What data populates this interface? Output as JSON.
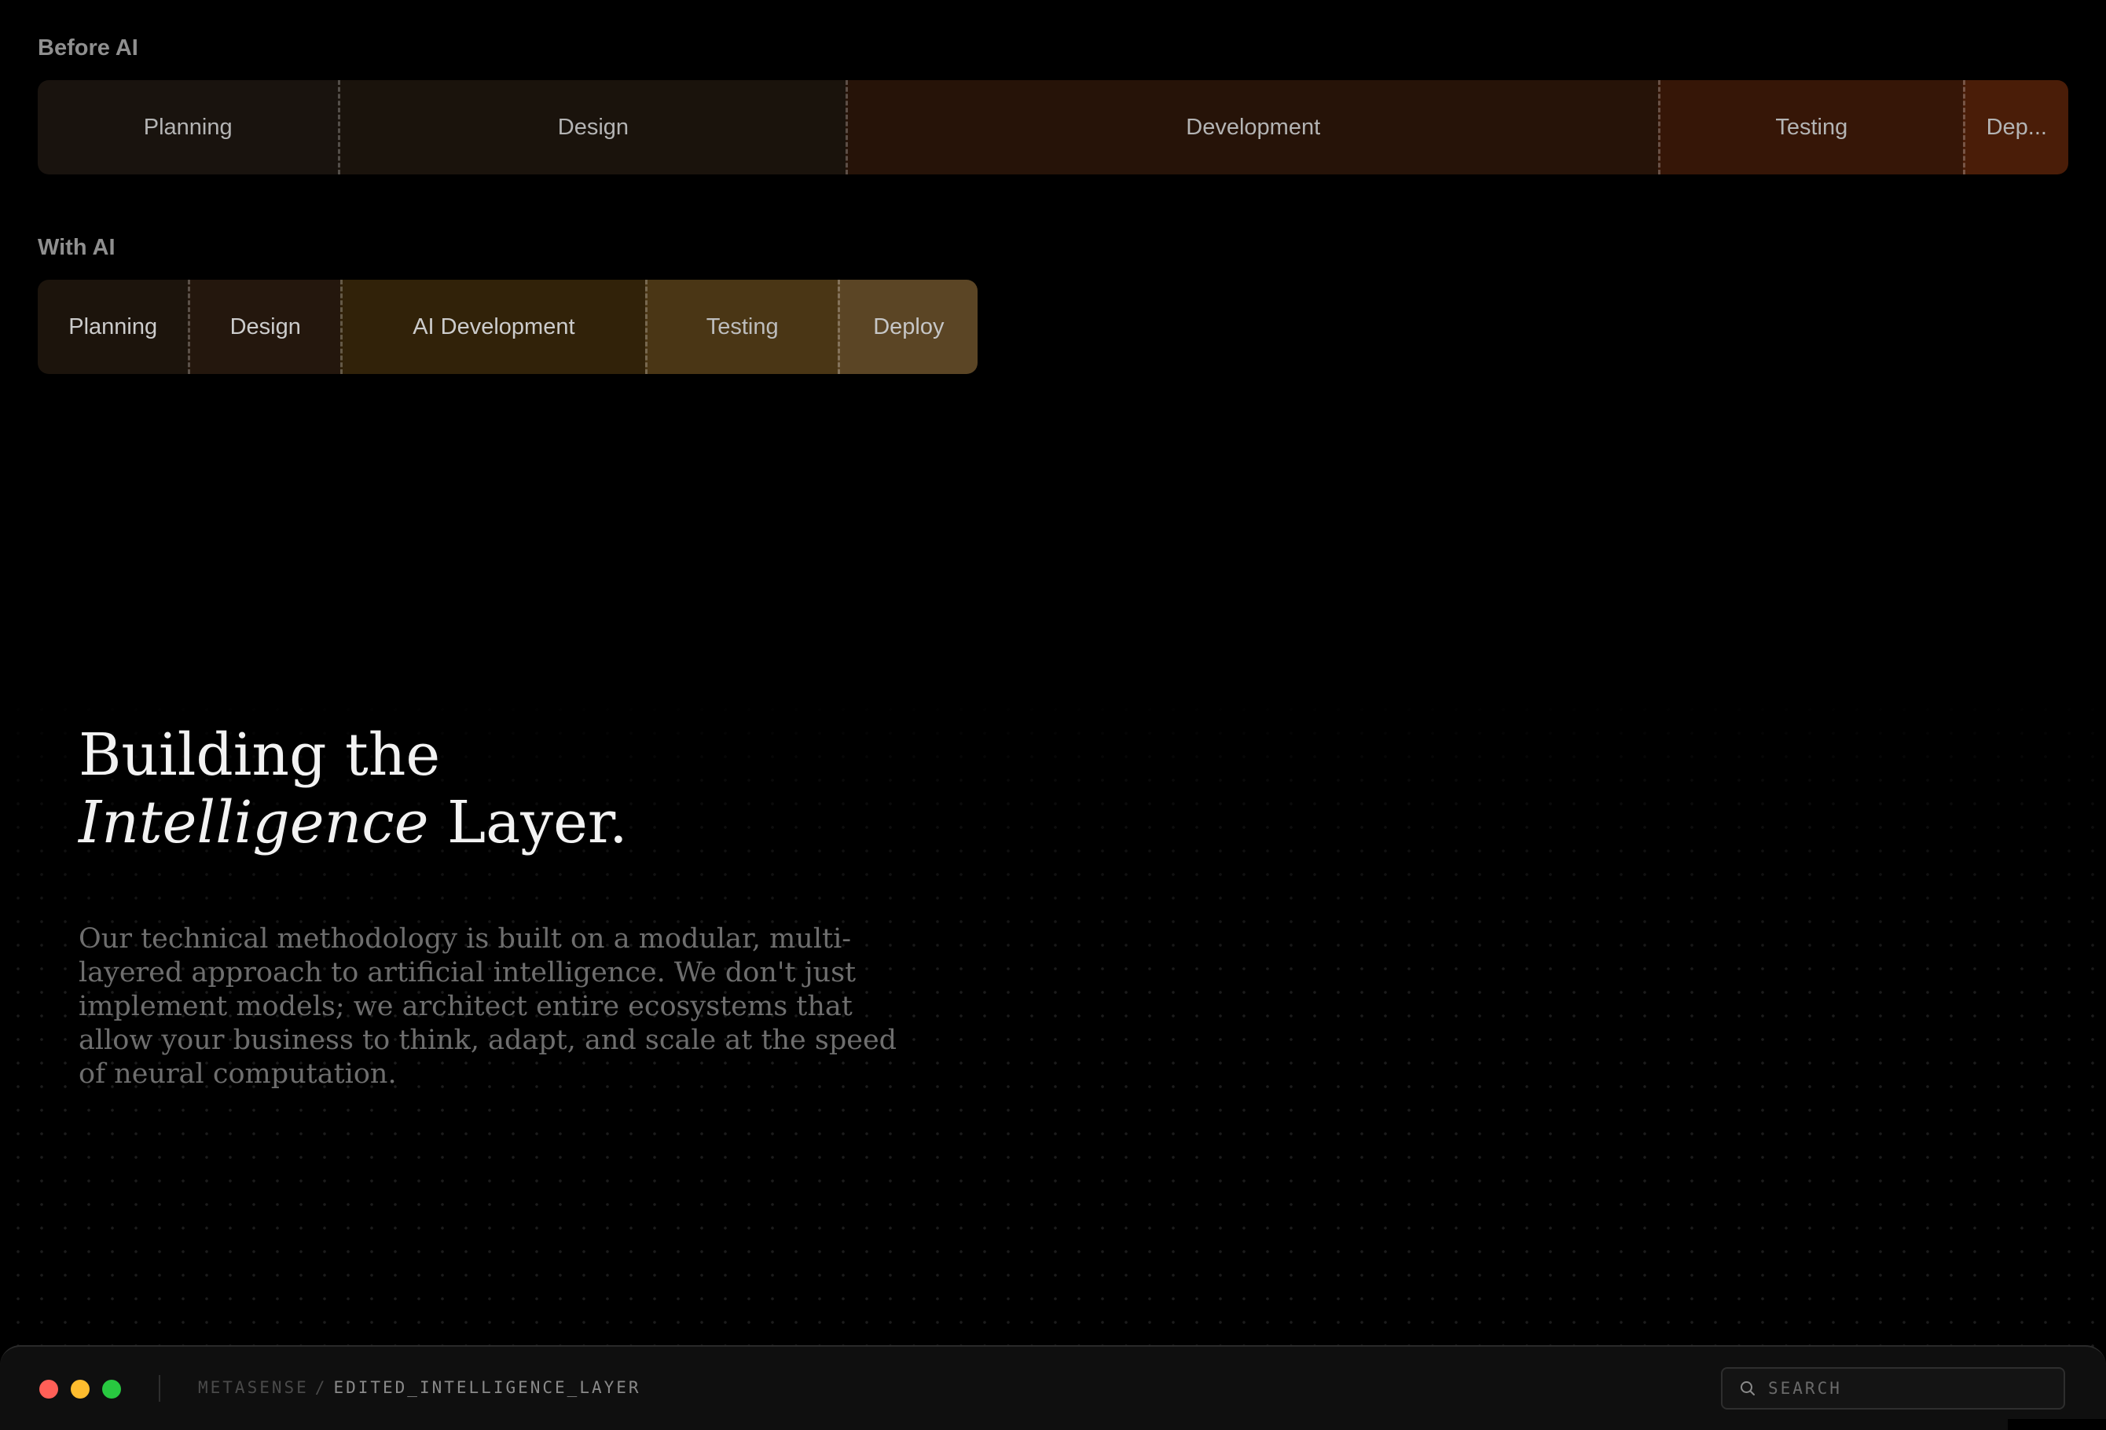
{
  "comparison": {
    "before": {
      "label": "Before AI",
      "phases": [
        {
          "name": "Planning",
          "share": 0.148,
          "color": "#19130e",
          "text_color": "#b4b4b4"
        },
        {
          "name": "Design",
          "share": 0.25,
          "color": "#1a130c",
          "text_color": "#b4b4b4"
        },
        {
          "name": "Development",
          "share": 0.4,
          "color": "#261308",
          "text_color": "#b4b4b4"
        },
        {
          "name": "Testing",
          "share": 0.15,
          "color": "#361607",
          "text_color": "#b4b4b4"
        },
        {
          "name": "Dep...",
          "share": 0.052,
          "color": "#4a1d08",
          "text_color": "#b4b4b4"
        }
      ]
    },
    "with_ai": {
      "label": "With AI",
      "phases": [
        {
          "name": "Planning",
          "share": 0.16,
          "color": "#1c140c",
          "text_color": "#cccccc"
        },
        {
          "name": "Design",
          "share": 0.162,
          "color": "#24170d",
          "text_color": "#cccccc"
        },
        {
          "name": "AI Development",
          "share": 0.324,
          "color": "#312209",
          "text_color": "#cccccc"
        },
        {
          "name": "Testing",
          "share": 0.205,
          "color": "#4a3615",
          "text_color": "#bdbdbd"
        },
        {
          "name": "Deploy",
          "share": 0.149,
          "color": "#5b4525",
          "text_color": "#c6c6c6"
        }
      ]
    }
  },
  "hero": {
    "title_line1": "Building the",
    "title_italic": "Intelligence",
    "title_rest": " Layer.",
    "description": "Our technical methodology is built on a modular, multi-layered approach to artificial intelligence. We don't just implement models; we architect entire ecosystems that allow your business to think, adapt, and scale at the speed of neural computation."
  },
  "taskbar": {
    "window_controls": [
      {
        "name": "close",
        "color": "#ff5f57"
      },
      {
        "name": "minimize",
        "color": "#febc2e"
      },
      {
        "name": "maximize",
        "color": "#28c840"
      }
    ],
    "breadcrumb_root": "METASENSE",
    "breadcrumb_separator": "/",
    "breadcrumb_current": "EDITED_INTELLIGENCE_LAYER",
    "search_placeholder": "SEARCH",
    "search_icon": "search-icon"
  }
}
